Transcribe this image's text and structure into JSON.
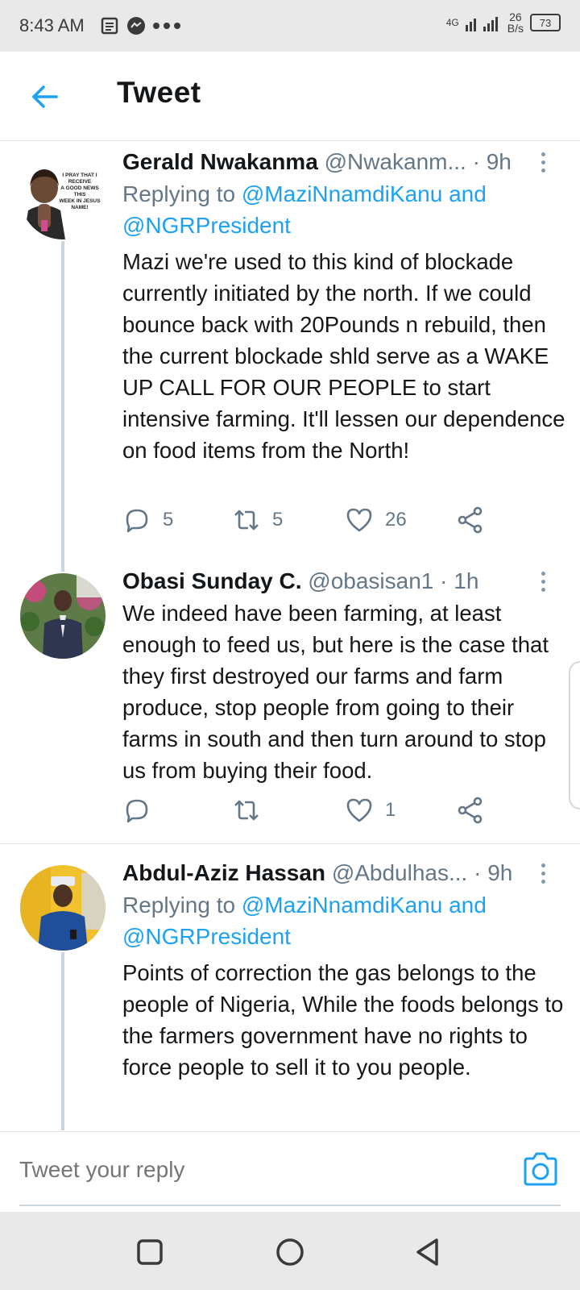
{
  "status_bar": {
    "time": "8:43 AM",
    "network_type": "4G",
    "speed_value": "26",
    "speed_unit": "B/s",
    "battery": "73"
  },
  "header": {
    "title": "Tweet"
  },
  "tweets": [
    {
      "name": "Gerald Nwakanma",
      "handle": "@Nwakanm...",
      "time": "· 9h",
      "replying_prefix": "Replying to",
      "replying_user1": "@MaziNnamdiKanu",
      "replying_and": "and",
      "replying_user2": "@NGRPresident",
      "avatar_caption": "I PRAY THAT I RECEIVE A GOOD NEWS THIS WEEK IN JESUS NAME!",
      "text": "Mazi we're used to this kind of blockade currently initiated by the north. If we could bounce back with 20Pounds n rebuild, then the current blockade shld serve as a WAKE UP CALL FOR OUR PEOPLE to start intensive farming. It'll lessen our dependence on food items from the North!",
      "replies": "5",
      "retweets": "5",
      "likes": "26"
    },
    {
      "name": "Obasi Sunday C.",
      "handle": "@obasisan1",
      "time": "· 1h",
      "text": "We indeed have been farming, at least enough to feed us, but here is the case that they first destroyed our farms and farm produce, stop people from going to their farms in south and then turn around to stop us from buying their food.",
      "replies": "",
      "retweets": "",
      "likes": "1"
    },
    {
      "name": "Abdul-Aziz Hassan",
      "handle": "@Abdulhas...",
      "time": "· 9h",
      "replying_prefix": "Replying to",
      "replying_user1": "@MaziNnamdiKanu",
      "replying_and": "and",
      "replying_user2": "@NGRPresident",
      "text": "Points of correction the gas belongs to the people of Nigeria, While the foods belongs to the farmers government have no rights to force people to sell it to you people."
    }
  ],
  "reply_bar": {
    "placeholder": "Tweet your reply"
  },
  "colors": {
    "accent": "#1da1f2",
    "secondary_text": "#657786",
    "divider": "#e1e8ed"
  },
  "icons": [
    "back-arrow-icon",
    "reply-icon",
    "retweet-icon",
    "like-icon",
    "share-icon",
    "camera-icon",
    "more-icon"
  ]
}
